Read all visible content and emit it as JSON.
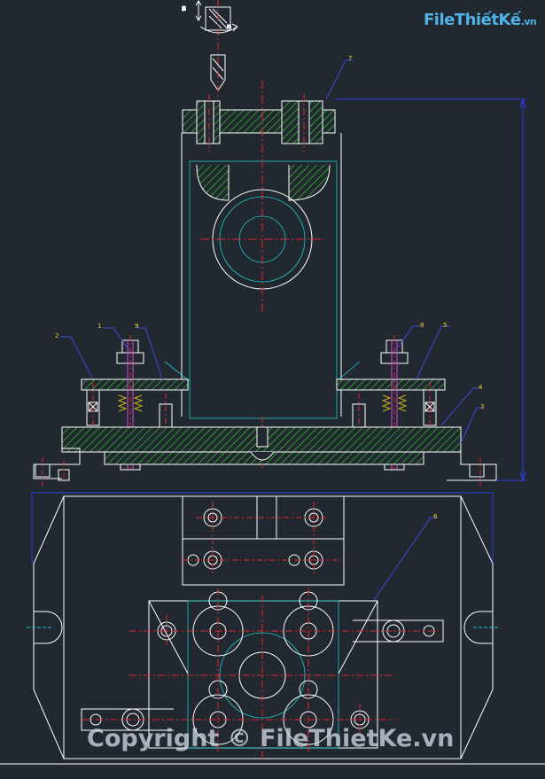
{
  "watermark": {
    "logo_text": "FileThiếtKế",
    "logo_suffix": ".vn",
    "copyright": "Copyright © FileThietKe.vn"
  },
  "annotations": {
    "feed_symbol": "S",
    "rotation_symbol": "n"
  },
  "balloons": {
    "b1": "1",
    "b2": "2",
    "b3": "3",
    "b4": "4",
    "b5": "5",
    "b6": "6",
    "b7": "7",
    "b8": "8",
    "b9": "9"
  },
  "colors": {
    "background": "#212830",
    "outline": "#ffffff",
    "centerline": "#e8232a",
    "hatch": "#35d12f",
    "hidden": "#1ec9c9",
    "dimension": "#2f3ce8",
    "leader": "#3a4bd8",
    "balloon_text": "#f0d21a",
    "spring": "#c9b21e",
    "bolt": "#d04adf"
  }
}
